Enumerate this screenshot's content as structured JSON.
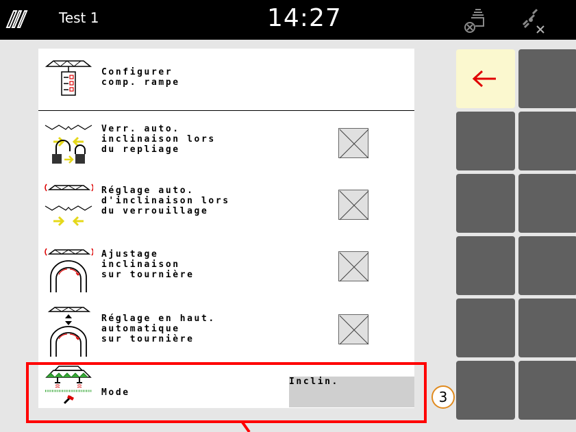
{
  "header": {
    "title": "Test 1",
    "time": "14:27",
    "logo_icon": "amazone-logo-icon",
    "implement_icon": "implement-status-icon",
    "gps_icon": "gps-disconnected-icon"
  },
  "menu": {
    "items": [
      {
        "label": "Configurer\ncomp. rampe",
        "icon": "boom-configuration-icon"
      },
      {
        "label": "Verr. auto.\ninclinaison lors\ndu repliage",
        "icon": "auto-lock-tilt-folding-icon",
        "checked": false
      },
      {
        "label": "Réglage auto.\nd'inclinaison lors\ndu verrouillage",
        "icon": "auto-tilt-adjust-locking-icon",
        "checked": false
      },
      {
        "label": "Ajustage\ninclinaison\nsur tournière",
        "icon": "tilt-adjust-headland-icon",
        "checked": false
      },
      {
        "label": "Réglage en haut.\nautomatique\nsur tournière",
        "icon": "auto-height-headland-icon",
        "checked": false
      },
      {
        "label": "Mode",
        "icon": "boom-mode-icon",
        "value": "Inclin."
      }
    ]
  },
  "callout": {
    "number": "3"
  },
  "softkeys": {
    "back_icon": "back-arrow-icon"
  },
  "colors": {
    "header_bg": "#000000",
    "highlight": "#ff0000",
    "badge_border": "#e08a1e",
    "softkey": "#606060",
    "softkey_active": "#fbf8cf",
    "arrow": "#e00000",
    "yellow_arrow": "#f2f21e"
  }
}
